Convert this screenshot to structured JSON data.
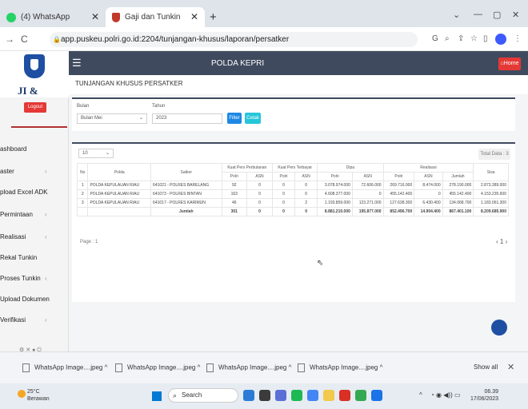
{
  "browser": {
    "tabs": [
      {
        "label": "(4) WhatsApp"
      },
      {
        "label": "Gaji dan Tunkin"
      }
    ],
    "url": "app.puskeu.polri.go.id:2204/tunjangan-khusus/laporan/persatker"
  },
  "app": {
    "logo_text": "JI & TUNKIN",
    "header_title": "POLDA KEPRI",
    "home_label": "Home",
    "logout_label": "Logout",
    "page_title": "TUNJANGAN KHUSUS PERSATKER"
  },
  "sidebar": {
    "items": [
      {
        "label": "ashboard"
      },
      {
        "label": "aster"
      },
      {
        "label": "pload Excel ADK"
      },
      {
        "label": "Permintaan"
      },
      {
        "label": "Realisasi"
      },
      {
        "label": "Rekal Tunkin"
      },
      {
        "label": "Proses Tunkin"
      },
      {
        "label": "Upload Dokumen"
      },
      {
        "label": "Verifikasi"
      }
    ]
  },
  "filter": {
    "bulan_label": "Bulan",
    "bulan_value": "Bulan Mei",
    "tahun_label": "Tahun",
    "tahun_value": "2023",
    "filter_button": "Filter",
    "print_button": "Cetak"
  },
  "table": {
    "page_size": "10",
    "total_label": "Total Data : 3",
    "headers": {
      "no": "No",
      "polda": "Polda",
      "satker": "Satker",
      "kuat_pers_perbulan": "Kuat Pers Perbulanan",
      "kuat_pers_terbayar": "Kuat Pers Terbayar",
      "dipa": "Dipa",
      "realisasi": "Realisasi",
      "sisa": "Sisa",
      "polri": "Polri",
      "asn": "ASN",
      "jumlah": "Jumlah"
    },
    "rows": [
      {
        "no": "1",
        "polda": "POLDA KEPULAUAN RIAU",
        "satker": "641021 - POLRES BARELANG",
        "kp_polri": "92",
        "kp_asn": "0",
        "kt_polri": "0",
        "kt_asn": "0",
        "dipa_polri": "3.078.974.000",
        "dipa_asn": "72.606.000",
        "real_polri": "269.716.000",
        "real_asn": "8.474.000",
        "real_jumlah": "278.190.000",
        "sisa": "2.873.389.000"
      },
      {
        "no": "2",
        "polda": "POLDA KEPULAUAN RIAU",
        "satker": "641073 - POLRES BINTAN",
        "kp_polri": "163",
        "kp_asn": "0",
        "kt_polri": "0",
        "kt_asn": "0",
        "dipa_polri": "4.608.377.000",
        "dipa_asn": "0",
        "real_polri": "455.142.400",
        "real_asn": "0",
        "real_jumlah": "455.142.400",
        "sisa": "4.153.235.600"
      },
      {
        "no": "3",
        "polda": "POLDA KEPULAUAN RIAU",
        "satker": "641017 - POLRES KARIMUN",
        "kp_polri": "46",
        "kp_asn": "0",
        "kt_polri": "0",
        "kt_asn": "2",
        "dipa_polri": "1.193.859.000",
        "dipa_asn": "123.271.000",
        "real_polri": "127.638.300",
        "real_asn": "6.430.400",
        "real_jumlah": "134.068.700",
        "sisa": "1.183.061.300"
      }
    ],
    "total": {
      "label": "Jumlah",
      "kp_polri": "301",
      "kp_asn": "0",
      "kt_polri": "0",
      "kt_asn": "0",
      "dipa_polri": "8.881.210.000",
      "dipa_asn": "195.877.000",
      "real_polri": "852.496.700",
      "real_asn": "14.904.400",
      "real_jumlah": "867.401.100",
      "sisa": "8.209.685.900"
    },
    "page_info": "Page : 1"
  },
  "downloads": [
    {
      "label": "WhatsApp Image....jpeg"
    },
    {
      "label": "WhatsApp Image....jpeg"
    },
    {
      "label": "WhatsApp Image....jpeg"
    },
    {
      "label": "WhatsApp Image....jpeg"
    }
  ],
  "downloads_show_all": "Show all",
  "taskbar": {
    "weather_temp": "25°C",
    "weather_desc": "Berawan",
    "search_label": "Search",
    "time": "06.39",
    "date": "17/06/2023"
  },
  "colors": {
    "nav": "#3f4a5e",
    "danger": "#e53935",
    "primary": "#1e88e5",
    "info": "#26c6da"
  }
}
